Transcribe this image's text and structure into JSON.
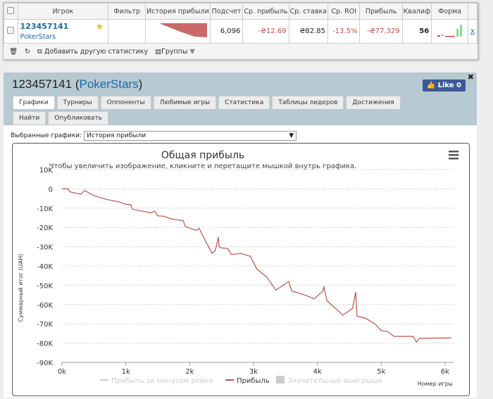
{
  "table": {
    "headers": [
      "Игрок",
      "Фильтр",
      "История прибыли",
      "Подсчет",
      "Ср. прибыль",
      "Ср. ставка",
      "Ср. ROI",
      "Прибыль",
      "Квалиф",
      "Форма"
    ],
    "row": {
      "player_id": "123457141",
      "network": "PokerStars",
      "count": "6,096",
      "avg_profit": "-₴12.69",
      "avg_stake": "₴82.85",
      "avg_roi": "-13.5%",
      "profit": "-₴77,329",
      "qualif": "56",
      "remove": "x"
    }
  },
  "toolbar": {
    "add_stat": "Добавить другую статистику",
    "groups": "Группы"
  },
  "panel": {
    "title_id": "123457141",
    "title_network": "PokerStars",
    "like": "Like 0",
    "tabs": [
      "Графики",
      "Турниры",
      "Оппоненты",
      "Любимые игры",
      "Статистика",
      "Таблицы лидеров",
      "Достижения",
      "Найти",
      "Опубликовать"
    ],
    "selected_label": "Выбранные графики:",
    "selected_value": "История прибыли"
  },
  "colors": {
    "profit_line": "#c0504d",
    "panel_bg": "#b7c9d1",
    "link": "#1a6aa8"
  },
  "chart_data": {
    "type": "line",
    "title": "Общая прибыль",
    "subtitle": "Чтобы увеличить изображение, кликните и перетащите мышкой внутрь графика.",
    "xlabel": "Номер игры",
    "ylabel": "Суммарный итог (UAH)",
    "xlim": [
      0,
      6100
    ],
    "ylim": [
      -90000,
      10000
    ],
    "xticks": [
      "0k",
      "1k",
      "2k",
      "3k",
      "4k",
      "5k",
      "6k"
    ],
    "yticks": [
      "10K",
      "0",
      "-10K",
      "-20K",
      "-30K",
      "-40K",
      "-50K",
      "-60K",
      "-70K",
      "-80K",
      "-90K"
    ],
    "grid": true,
    "legend_position": "bottom",
    "legend": [
      {
        "name": "Прибыль за минусом рейка",
        "visible": false
      },
      {
        "name": "Прибыль",
        "visible": true
      },
      {
        "name": "Значительные выигрыши",
        "visible": false
      }
    ],
    "series": [
      {
        "name": "Прибыль",
        "x": [
          0,
          100,
          120,
          300,
          350,
          500,
          700,
          900,
          1000,
          1080,
          1100,
          1250,
          1400,
          1450,
          1500,
          1600,
          1700,
          1900,
          1930,
          2100,
          2150,
          2200,
          2350,
          2400,
          2450,
          2460,
          2480,
          2600,
          2650,
          2800,
          2850,
          2950,
          3050,
          3200,
          3350,
          3550,
          3600,
          3800,
          3950,
          4090,
          4100,
          4150,
          4250,
          4400,
          4550,
          4600,
          4620,
          4750,
          4900,
          5000,
          5100,
          5200,
          5500,
          5550,
          5600,
          6100
        ],
        "y": [
          0,
          0,
          -1500,
          -2800,
          -800,
          -3500,
          -5500,
          -6800,
          -8000,
          -8200,
          -10500,
          -11500,
          -12500,
          -11500,
          -14000,
          -14200,
          -15500,
          -16500,
          -19500,
          -21500,
          -20500,
          -24000,
          -33500,
          -32000,
          -25000,
          -30000,
          -30500,
          -31000,
          -34000,
          -33500,
          -34000,
          -35000,
          -41500,
          -45500,
          -52500,
          -48000,
          -53000,
          -55000,
          -57000,
          -53000,
          -50500,
          -58000,
          -61000,
          -65500,
          -62000,
          -53500,
          -66000,
          -67000,
          -70000,
          -73500,
          -74000,
          -76500,
          -76500,
          -79500,
          -77500,
          -77300
        ]
      }
    ]
  }
}
